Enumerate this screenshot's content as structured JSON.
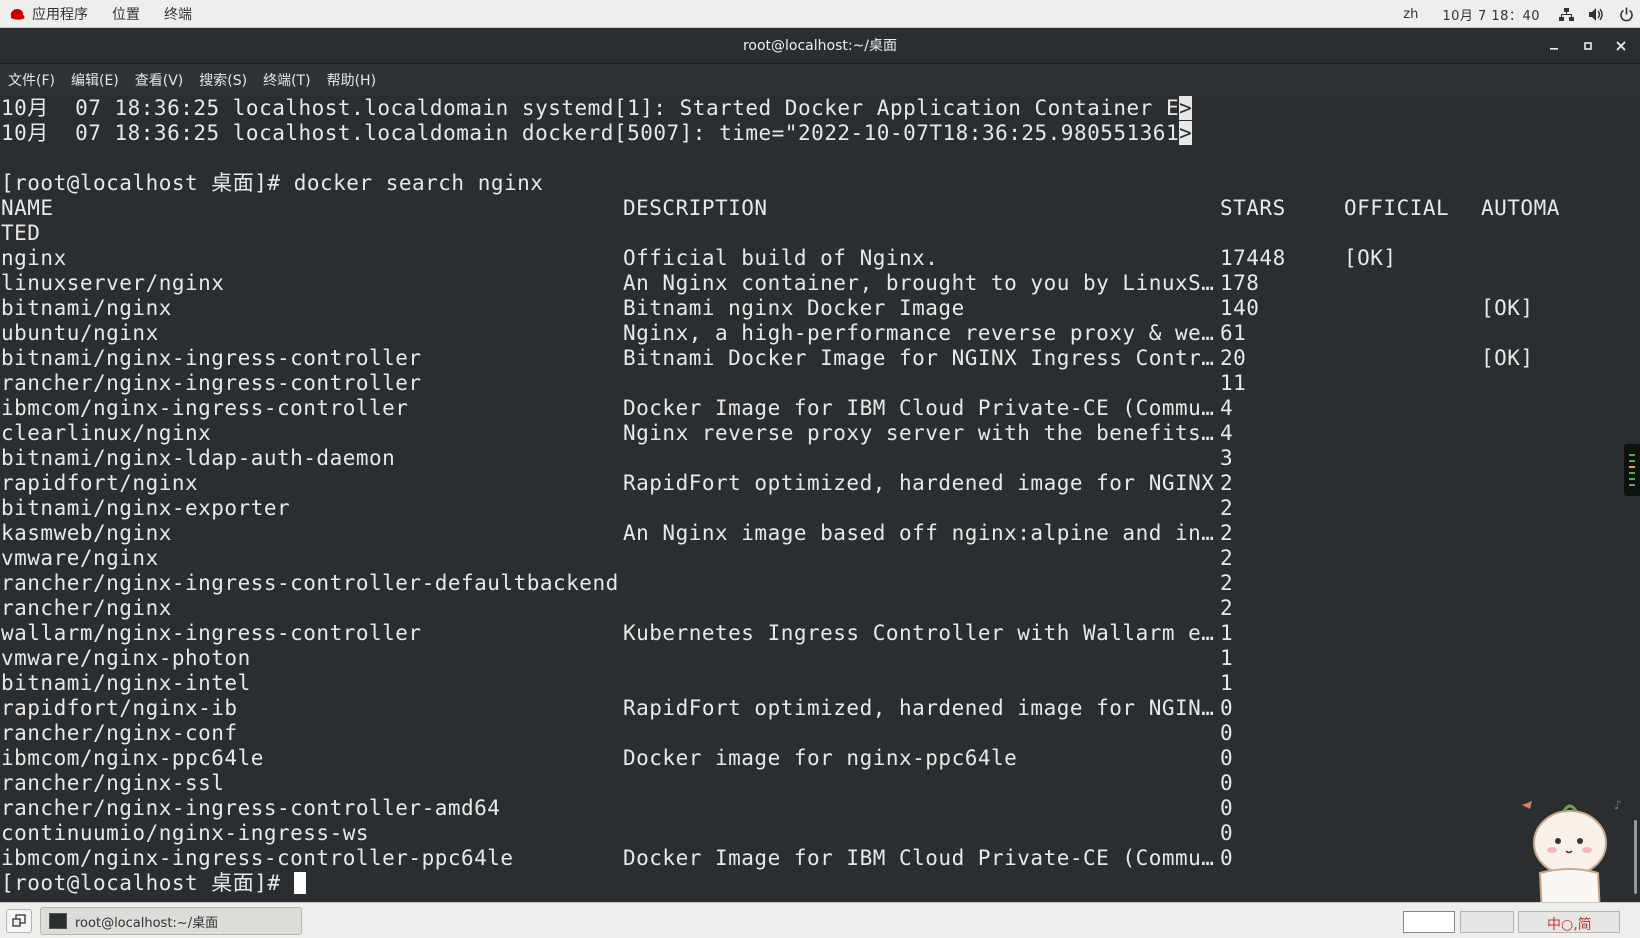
{
  "topbar": {
    "menus": [
      "应用程序",
      "位置",
      "终端"
    ],
    "lang": "zh",
    "clock": "10月 7 18：40",
    "icons": [
      "redhat-logo-icon",
      "network-icon",
      "volume-icon",
      "power-icon"
    ]
  },
  "window": {
    "title": "root@localhost:~/桌面",
    "controls": [
      "minimize-icon",
      "maximize-icon",
      "close-icon"
    ]
  },
  "menubar": [
    "文件(F)",
    "编辑(E)",
    "查看(V)",
    "搜索(S)",
    "终端(T)",
    "帮助(H)"
  ],
  "terminal": {
    "log_lines": [
      {
        "text": "10月  07 18:36:25 localhost.localdomain systemd[1]: Started Docker Application Container E",
        "tail": ">"
      },
      {
        "text": "10月  07 18:36:25 localhost.localdomain dockerd[5007]: time=\"2022-10-07T18:36:25.980551361",
        "tail": ">"
      }
    ],
    "command_line": "[root@localhost 桌面]# docker search nginx",
    "headers": {
      "name": "NAME",
      "description": "DESCRIPTION",
      "stars": "STARS",
      "official": "OFFICIAL",
      "automated": "AUTOMA",
      "wrap": "TED"
    },
    "rows": [
      {
        "name": "nginx",
        "description": "Official build of Nginx.",
        "stars": "17448",
        "official": "[OK]",
        "automated": ""
      },
      {
        "name": "linuxserver/nginx",
        "description": "An Nginx container, brought to you by LinuxS…",
        "stars": "178",
        "official": "",
        "automated": ""
      },
      {
        "name": "bitnami/nginx",
        "description": "Bitnami nginx Docker Image",
        "stars": "140",
        "official": "",
        "automated": "[OK]"
      },
      {
        "name": "ubuntu/nginx",
        "description": "Nginx, a high-performance reverse proxy & we…",
        "stars": "61",
        "official": "",
        "automated": ""
      },
      {
        "name": "bitnami/nginx-ingress-controller",
        "description": "Bitnami Docker Image for NGINX Ingress Contr…",
        "stars": "20",
        "official": "",
        "automated": "[OK]"
      },
      {
        "name": "rancher/nginx-ingress-controller",
        "description": "",
        "stars": "11",
        "official": "",
        "automated": ""
      },
      {
        "name": "ibmcom/nginx-ingress-controller",
        "description": "Docker Image for IBM Cloud Private-CE (Commu…",
        "stars": "4",
        "official": "",
        "automated": ""
      },
      {
        "name": "clearlinux/nginx",
        "description": "Nginx reverse proxy server with the benefits…",
        "stars": "4",
        "official": "",
        "automated": ""
      },
      {
        "name": "bitnami/nginx-ldap-auth-daemon",
        "description": "",
        "stars": "3",
        "official": "",
        "automated": ""
      },
      {
        "name": "rapidfort/nginx",
        "description": "RapidFort optimized, hardened image for NGINX",
        "stars": "2",
        "official": "",
        "automated": ""
      },
      {
        "name": "bitnami/nginx-exporter",
        "description": "",
        "stars": "2",
        "official": "",
        "automated": ""
      },
      {
        "name": "kasmweb/nginx",
        "description": "An Nginx image based off nginx:alpine and in…",
        "stars": "2",
        "official": "",
        "automated": ""
      },
      {
        "name": "vmware/nginx",
        "description": "",
        "stars": "2",
        "official": "",
        "automated": ""
      },
      {
        "name": "rancher/nginx-ingress-controller-defaultbackend",
        "description": "",
        "stars": "2",
        "official": "",
        "automated": ""
      },
      {
        "name": "rancher/nginx",
        "description": "",
        "stars": "2",
        "official": "",
        "automated": ""
      },
      {
        "name": "wallarm/nginx-ingress-controller",
        "description": "Kubernetes Ingress Controller with Wallarm e…",
        "stars": "1",
        "official": "",
        "automated": ""
      },
      {
        "name": "vmware/nginx-photon",
        "description": "",
        "stars": "1",
        "official": "",
        "automated": ""
      },
      {
        "name": "bitnami/nginx-intel",
        "description": "",
        "stars": "1",
        "official": "",
        "automated": ""
      },
      {
        "name": "rapidfort/nginx-ib",
        "description": "RapidFort optimized, hardened image for NGIN…",
        "stars": "0",
        "official": "",
        "automated": ""
      },
      {
        "name": "rancher/nginx-conf",
        "description": "",
        "stars": "0",
        "official": "",
        "automated": ""
      },
      {
        "name": "ibmcom/nginx-ppc64le",
        "description": "Docker image for nginx-ppc64le",
        "stars": "0",
        "official": "",
        "automated": ""
      },
      {
        "name": "rancher/nginx-ssl",
        "description": "",
        "stars": "0",
        "official": "",
        "automated": ""
      },
      {
        "name": "rancher/nginx-ingress-controller-amd64",
        "description": "",
        "stars": "0",
        "official": "",
        "automated": ""
      },
      {
        "name": "continuumio/nginx-ingress-ws",
        "description": "",
        "stars": "0",
        "official": "",
        "automated": ""
      },
      {
        "name": "ibmcom/nginx-ingress-controller-ppc64le",
        "description": "Docker Image for IBM Cloud Private-CE (Commu…",
        "stars": "0",
        "official": "",
        "automated": ""
      }
    ],
    "prompt": "[root@localhost 桌面]# "
  },
  "taskbar": {
    "task_label": "root@localhost:~/桌面",
    "mascot_text": "中○,简",
    "icons": [
      "show-desktop-icon",
      "terminal-icon"
    ]
  }
}
